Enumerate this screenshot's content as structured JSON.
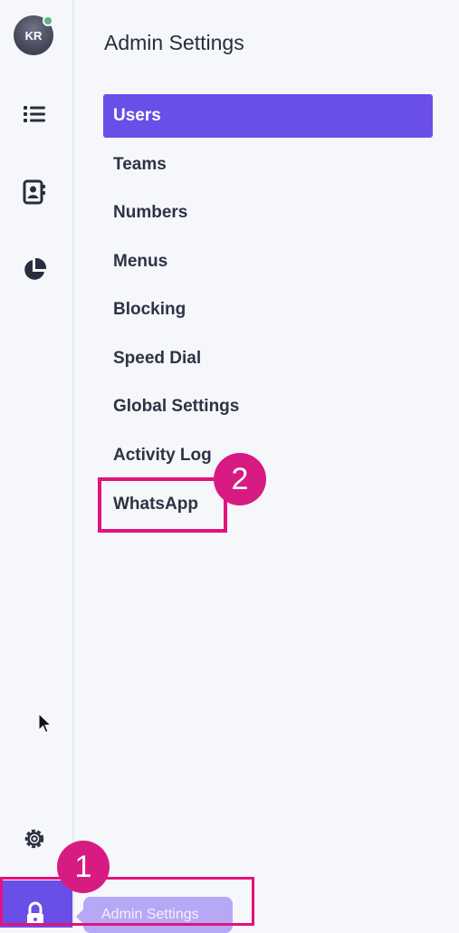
{
  "user": {
    "initials": "KR"
  },
  "page": {
    "title": "Admin Settings"
  },
  "menu": {
    "items": [
      {
        "label": "Users",
        "active": true
      },
      {
        "label": "Teams"
      },
      {
        "label": "Numbers"
      },
      {
        "label": "Menus"
      },
      {
        "label": "Blocking"
      },
      {
        "label": "Speed Dial"
      },
      {
        "label": "Global Settings"
      },
      {
        "label": "Activity Log"
      },
      {
        "label": "WhatsApp"
      }
    ]
  },
  "rail": {
    "icons": [
      "list-icon",
      "contacts-icon",
      "reports-pie-icon",
      "settings-gear-icon",
      "admin-lock-icon"
    ]
  },
  "tooltip": {
    "label": "Admin Settings"
  },
  "annotations": {
    "step1": "1",
    "step2": "2"
  },
  "colors": {
    "accent": "#6a4ee8",
    "highlight": "#e2137c",
    "presence": "#56b887"
  }
}
